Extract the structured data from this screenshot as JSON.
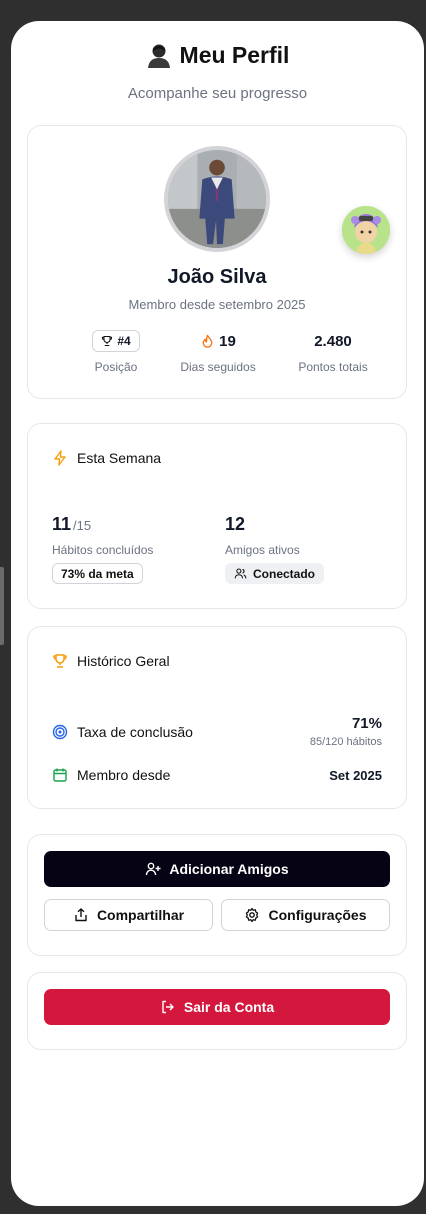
{
  "header": {
    "title": "Meu Perfil",
    "subtitle": "Acompanhe seu progresso",
    "title_icon": "person-icon"
  },
  "profile": {
    "name": "João Silva",
    "member_since": "Membro desde setembro 2025",
    "stats": [
      {
        "value": "#4",
        "label": "Posição",
        "icon": "trophy-icon"
      },
      {
        "value": "19",
        "label": "Dias seguidos",
        "icon": "flame-icon"
      },
      {
        "value": "2.480",
        "label": "Pontos totais"
      }
    ]
  },
  "week": {
    "title": "Esta Semana",
    "icon": "lightning-icon",
    "habits": {
      "value": "11",
      "of": "/15",
      "label": "Hábitos concluídos",
      "chip": "73% da meta"
    },
    "friends": {
      "value": "12",
      "label": "Amigos ativos",
      "chip": "Conectado"
    }
  },
  "history": {
    "title": "Histórico Geral",
    "icon": "trophy-icon",
    "rows": [
      {
        "label": "Taxa de conclusão",
        "value": "71%",
        "sub": "85/120 hábitos",
        "icon": "target-icon"
      },
      {
        "label": "Membro desde",
        "value": "Set 2025",
        "icon": "calendar-icon"
      }
    ]
  },
  "actions": {
    "add_friends": "Adicionar Amigos",
    "share": "Compartilhar",
    "settings": "Configurações"
  },
  "logout": {
    "label": "Sair da Conta"
  },
  "colors": {
    "primary_dark": "#050314",
    "danger": "#d4183d",
    "accent_orange": "#f59e0b",
    "accent_blue": "#2563eb",
    "accent_green": "#16a34a",
    "muted_text": "#6b7280"
  }
}
